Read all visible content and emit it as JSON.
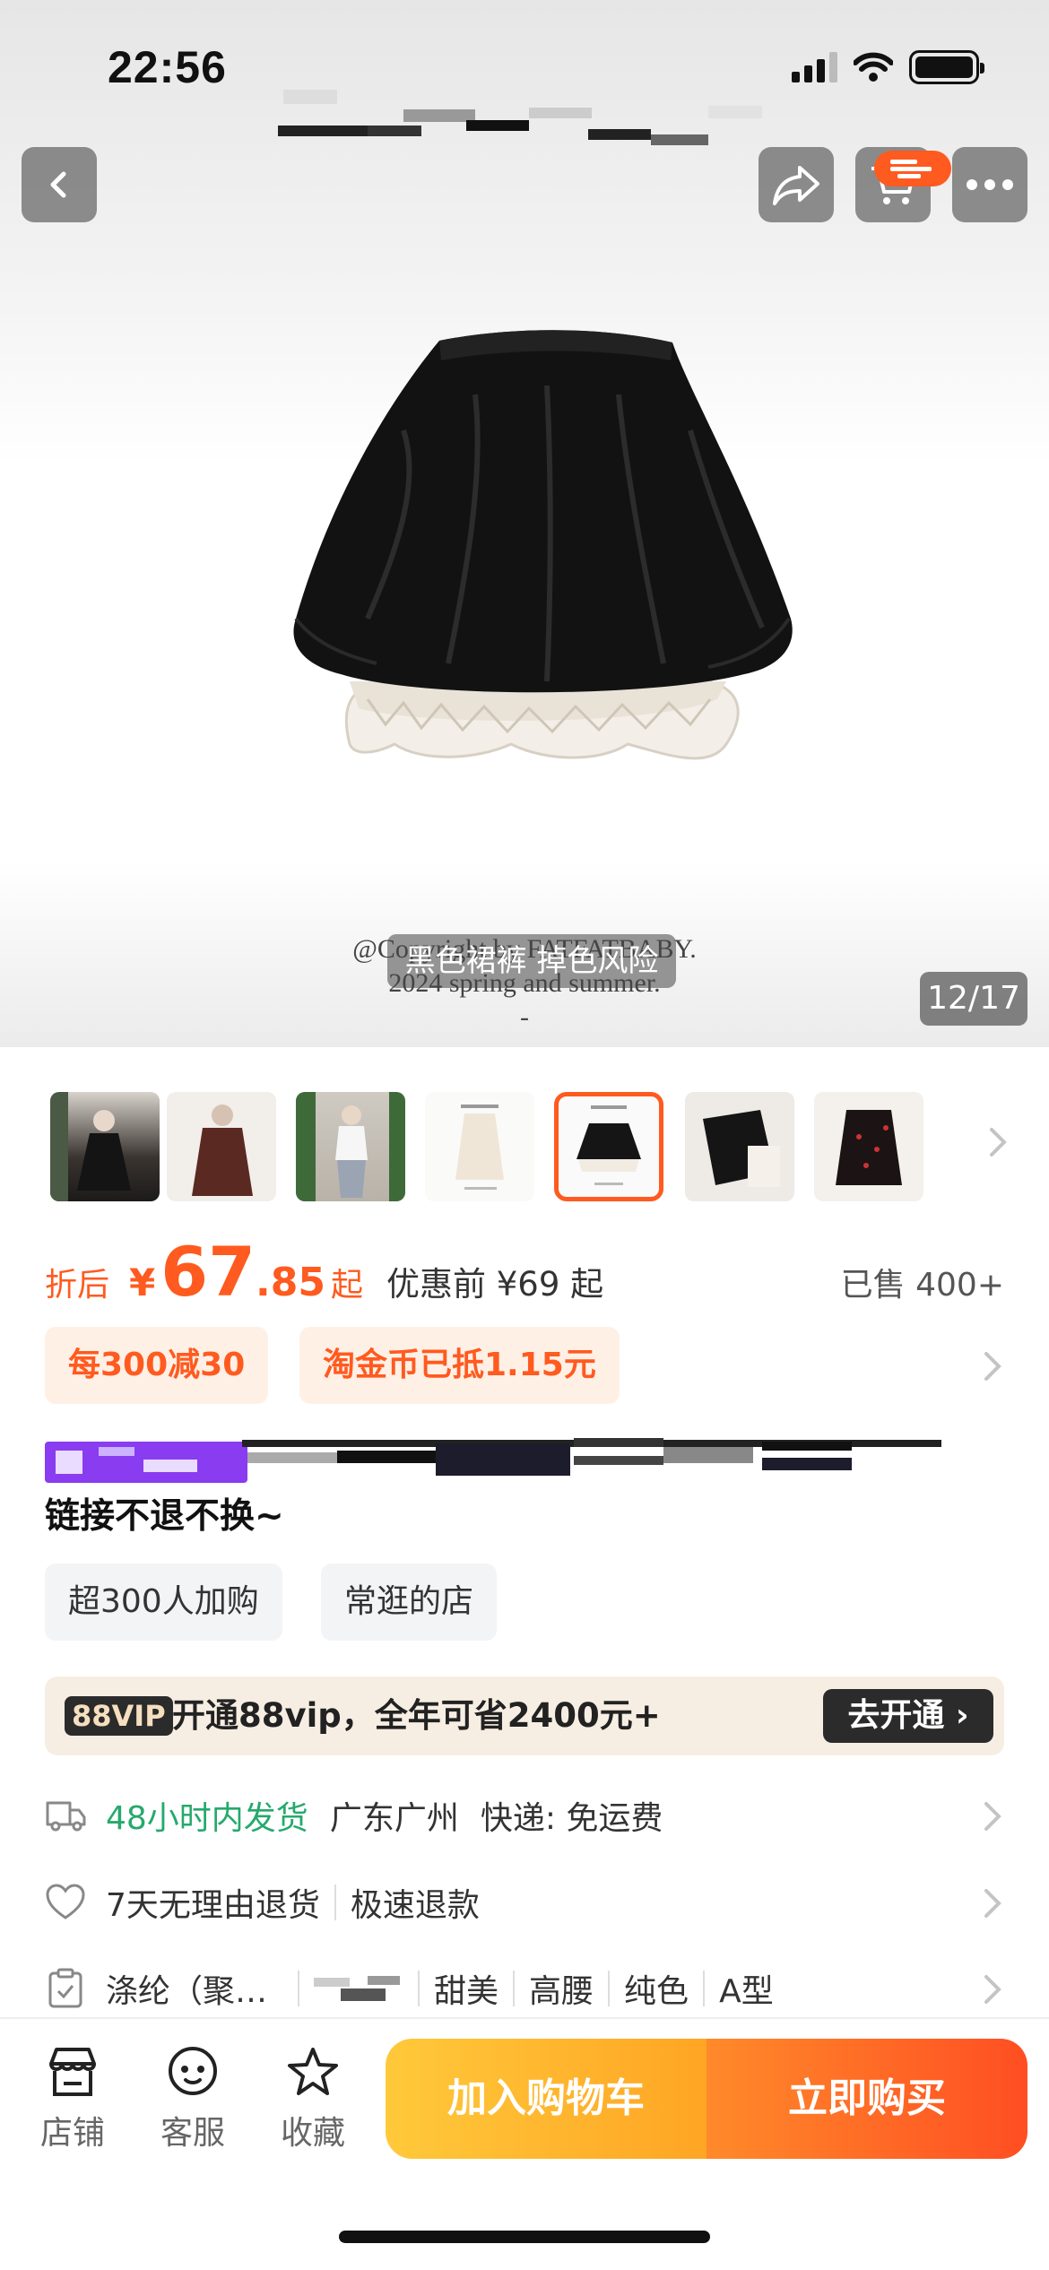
{
  "status_bar": {
    "time": "22:56"
  },
  "gallery": {
    "watermark_line1": "@Copyright by FATFATBABY.",
    "watermark_line2": "2024 spring and summer.",
    "watermark_line3": "-",
    "caption": "黑色裙裤 掉色风险",
    "counter": "12/17",
    "selected_thumb_index": 5
  },
  "price": {
    "label": "折后",
    "currency": "¥",
    "integer": "67",
    "decimal": ".85",
    "suffix": "起",
    "before_label": "优惠前 ¥69 起",
    "sold": "已售 400+"
  },
  "coupons": [
    "每300减30",
    "淘金币已抵1.15元"
  ],
  "title": {
    "line2": "链接不退不换~"
  },
  "tags": [
    "超300人加购",
    "常逛的店"
  ],
  "vip": {
    "badge": "88VIP",
    "text": "开通88vip，全年可省2400元+",
    "button": "去开通 ›"
  },
  "shipping": {
    "time": "48小时内发货",
    "location": "广东广州",
    "method": "快递: 免运费"
  },
  "returns": {
    "policy": "7天无理由退货",
    "refund": "极速退款"
  },
  "attributes": {
    "material": "涤纶（聚…",
    "items": [
      "甜美",
      "高腰",
      "纯色",
      "A型"
    ]
  },
  "bottom_bar": {
    "store": "店铺",
    "service": "客服",
    "favorite": "收藏",
    "add_to_cart": "加入购物车",
    "buy_now": "立即购买"
  },
  "colors": {
    "accent": "#ff5a1f",
    "green": "#26a96c",
    "vip_bg": "#f7eee3"
  }
}
